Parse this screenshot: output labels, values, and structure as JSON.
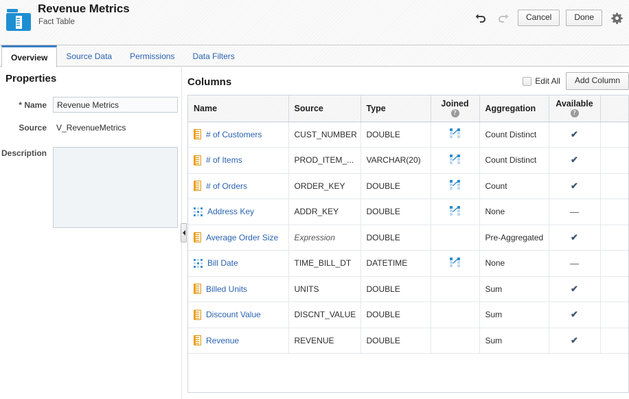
{
  "header": {
    "icon": "fact-table-icon",
    "title": "Revenue Metrics",
    "subtitle": "Fact Table",
    "undo_icon": "undo-icon",
    "redo_icon": "redo-icon",
    "cancel_label": "Cancel",
    "done_label": "Done",
    "gear_icon": "gear-icon"
  },
  "tabs": [
    {
      "label": "Overview",
      "active": true
    },
    {
      "label": "Source Data",
      "active": false
    },
    {
      "label": "Permissions",
      "active": false
    },
    {
      "label": "Data Filters",
      "active": false
    }
  ],
  "properties": {
    "title": "Properties",
    "name_label": "Name",
    "name_required_marker": "*",
    "name_value": "Revenue Metrics",
    "source_label": "Source",
    "source_value": "V_RevenueMetrics",
    "description_label": "Description",
    "description_value": ""
  },
  "splitter": {
    "collapse_icon": "collapse-left-arrow-icon"
  },
  "columns_panel": {
    "title": "Columns",
    "edit_all_label": "Edit All",
    "edit_all_checked": false,
    "add_column_label": "Add Column",
    "headers": [
      {
        "label": "Name",
        "help": false
      },
      {
        "label": "Source",
        "help": false
      },
      {
        "label": "Type",
        "help": false
      },
      {
        "label": "Joined",
        "help": true,
        "help_glyph": "?"
      },
      {
        "label": "Aggregation",
        "help": false
      },
      {
        "label": "Available",
        "help": true,
        "help_glyph": "?"
      },
      {
        "label": "",
        "help": false
      }
    ],
    "rows": [
      {
        "icon": "measure-icon",
        "name": "# of Customers",
        "source": "CUST_NUMBER",
        "source_is_expression": false,
        "type": "DOUBLE",
        "joined": true,
        "aggregation": "Count Distinct",
        "available": "check"
      },
      {
        "icon": "measure-icon",
        "name": "# of Items",
        "source": "PROD_ITEM_...",
        "source_is_expression": false,
        "type": "VARCHAR(20)",
        "joined": true,
        "aggregation": "Count Distinct",
        "available": "check"
      },
      {
        "icon": "measure-icon",
        "name": "# of Orders",
        "source": "ORDER_KEY",
        "source_is_expression": false,
        "type": "DOUBLE",
        "joined": true,
        "aggregation": "Count",
        "available": "check"
      },
      {
        "icon": "attribute-icon",
        "name": "Address Key",
        "source": "ADDR_KEY",
        "source_is_expression": false,
        "type": "DOUBLE",
        "joined": true,
        "aggregation": "None",
        "available": "dash"
      },
      {
        "icon": "measure-icon",
        "name": "Average Order Size",
        "source": "Expression",
        "source_is_expression": true,
        "type": "DOUBLE",
        "joined": false,
        "aggregation": "Pre-Aggregated",
        "available": "check"
      },
      {
        "icon": "attribute-icon",
        "name": "Bill Date",
        "source": "TIME_BILL_DT",
        "source_is_expression": false,
        "type": "DATETIME",
        "joined": true,
        "aggregation": "None",
        "available": "dash"
      },
      {
        "icon": "measure-icon",
        "name": "Billed Units",
        "source": "UNITS",
        "source_is_expression": false,
        "type": "DOUBLE",
        "joined": false,
        "aggregation": "Sum",
        "available": "check"
      },
      {
        "icon": "measure-icon",
        "name": "Discount Value",
        "source": "DISCNT_VALUE",
        "source_is_expression": false,
        "type": "DOUBLE",
        "joined": false,
        "aggregation": "Sum",
        "available": "check"
      },
      {
        "icon": "measure-icon",
        "name": "Revenue",
        "source": "REVENUE",
        "source_is_expression": false,
        "type": "DOUBLE",
        "joined": false,
        "aggregation": "Sum",
        "available": "check"
      }
    ],
    "symbols": {
      "check": "✔",
      "dash": "—"
    }
  },
  "colors": {
    "accent_blue": "#2a62b0",
    "tab_active_border": "#3a7fc4",
    "measure_orange": "#f5a623",
    "attribute_blue": "#3e92d1",
    "icon_blue": "#1d8fd1"
  }
}
